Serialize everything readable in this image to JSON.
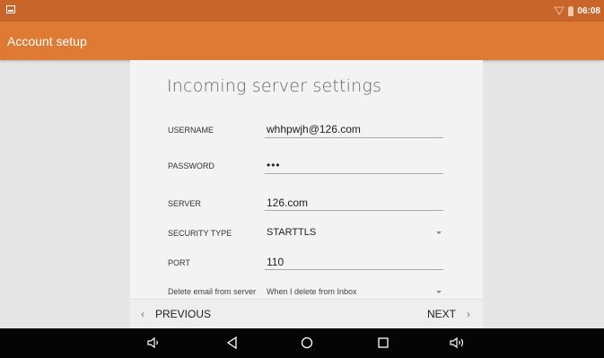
{
  "status": {
    "time": "06:08",
    "icons": [
      "notification-icon",
      "wifi-icon",
      "battery-icon"
    ]
  },
  "actionbar": {
    "title": "Account setup"
  },
  "form": {
    "heading": "Incoming server settings",
    "username_label": "USERNAME",
    "username_value": "whhpwjh@126.com",
    "password_label": "PASSWORD",
    "password_value": "•••",
    "server_label": "SERVER",
    "server_value": "126.com",
    "security_label": "SECURITY TYPE",
    "security_value": "STARTTLS",
    "port_label": "PORT",
    "port_value": "110",
    "delete_label": "Delete email from server",
    "delete_value": "When I delete from Inbox"
  },
  "footer": {
    "previous_label": "PREVIOUS",
    "next_label": "NEXT"
  },
  "navbar": {
    "icons": [
      "volume-down-icon",
      "back-icon",
      "home-icon",
      "recents-icon",
      "volume-up-icon"
    ]
  },
  "colors": {
    "statusbar": "#c8652a",
    "actionbar": "#df7a35",
    "background": "#e6e6e6",
    "panel": "#f3f3f3"
  }
}
